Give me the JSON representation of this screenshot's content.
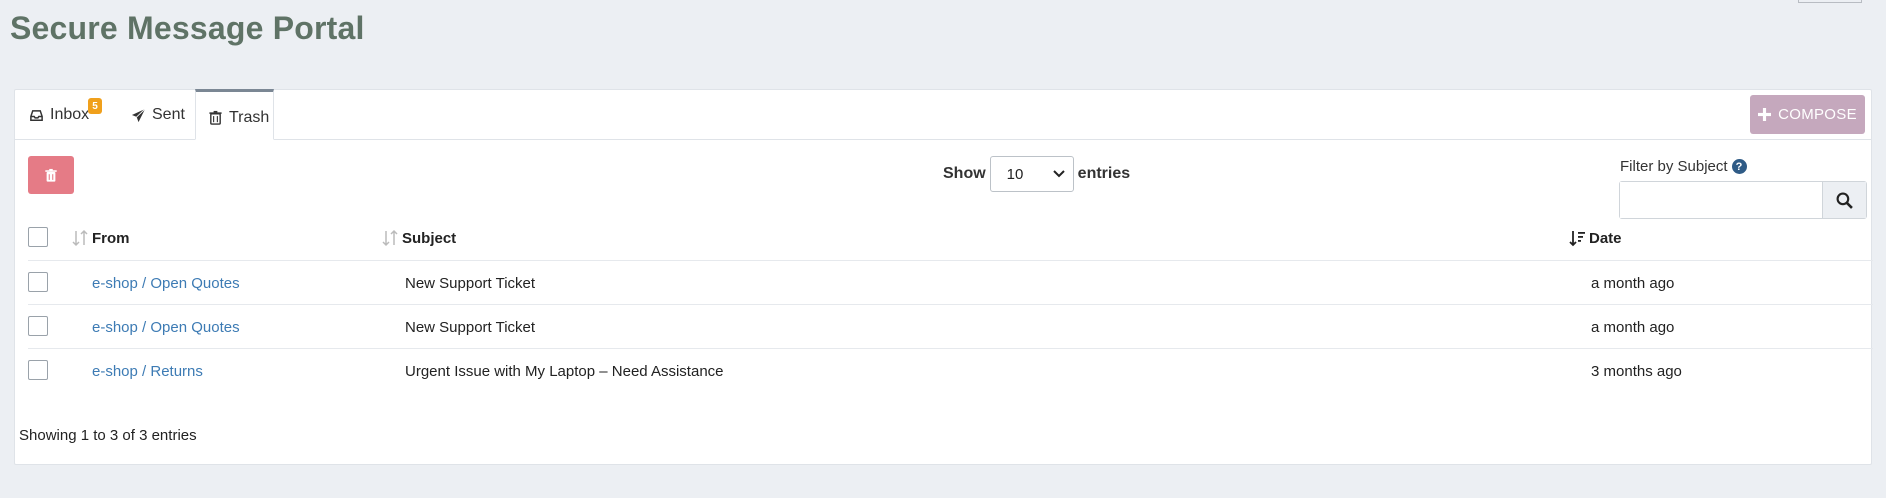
{
  "page": {
    "title": "Secure Message Portal"
  },
  "tabs": [
    {
      "label": "Inbox",
      "icon": "inbox-icon",
      "badge": "5"
    },
    {
      "label": "Sent",
      "icon": "paper-plane-icon"
    },
    {
      "label": "Trash",
      "icon": "trash-icon",
      "active": true
    }
  ],
  "toolbar": {
    "compose_label": "COMPOSE",
    "show_label": "Show",
    "entries_label": "entries",
    "page_size": "10",
    "filter_label": "Filter by Subject",
    "filter_value": ""
  },
  "table": {
    "columns": {
      "from": "From",
      "subject": "Subject",
      "date": "Date"
    },
    "rows": [
      {
        "from": "e-shop / Open Quotes",
        "subject": "New Support Ticket",
        "date": "a month ago"
      },
      {
        "from": "e-shop / Open Quotes",
        "subject": "New Support Ticket",
        "date": "a month ago"
      },
      {
        "from": "e-shop / Returns",
        "subject": "Urgent Issue with My Laptop – Need Assistance",
        "date": "3 months ago"
      }
    ],
    "summary": "Showing 1 to 3 of 3 entries"
  },
  "colors": {
    "title": "#5f7366",
    "compose": "#c5a8bd",
    "delete": "#e57b86",
    "badge": "#f0a01c",
    "link": "#3d7bb4"
  }
}
